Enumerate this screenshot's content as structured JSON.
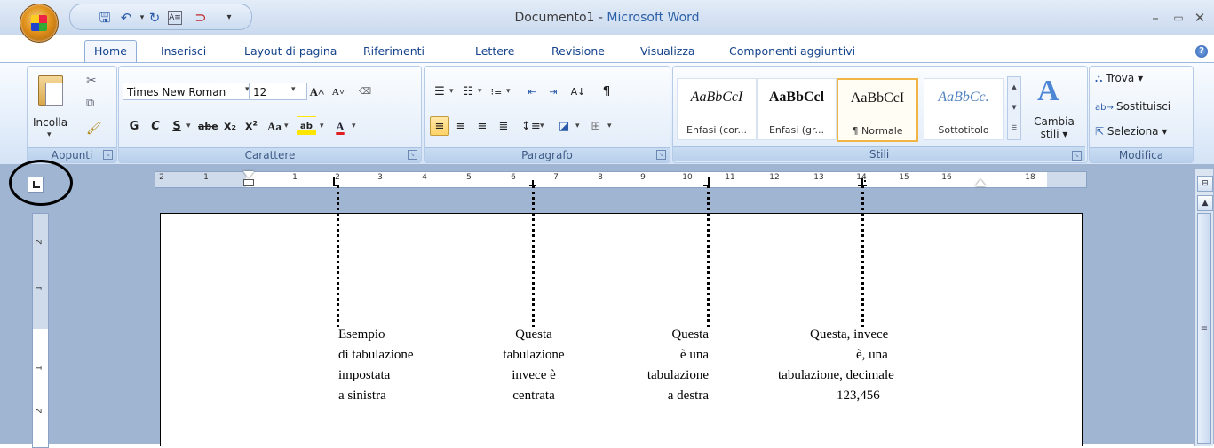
{
  "window": {
    "doc_name": "Documento1",
    "separator": " - ",
    "app_name": "Microsoft Word",
    "min_icon": "minimize-icon",
    "restore_icon": "restore-icon",
    "close_icon": "close-icon"
  },
  "quick_access": {
    "save_icon": "save-icon",
    "undo_icon": "undo-icon",
    "redo_icon": "redo-icon",
    "custom1_icon": "form-icon",
    "custom2_icon": "spelling-icon",
    "more_icon": "customize-qat-icon"
  },
  "tabs": [
    {
      "label": "Home"
    },
    {
      "label": "Inserisci"
    },
    {
      "label": "Layout di pagina"
    },
    {
      "label": "Riferimenti"
    },
    {
      "label": "Lettere"
    },
    {
      "label": "Revisione"
    },
    {
      "label": "Visualizza"
    },
    {
      "label": "Componenti aggiuntivi"
    }
  ],
  "clipboard": {
    "group_label": "Appunti",
    "paste_label": "Incolla"
  },
  "font": {
    "group_label": "Carattere",
    "family": "Times New Roman",
    "size": "12",
    "bold": "G",
    "italic": "C",
    "underline": "S",
    "strike": "abe",
    "subscript": "x₂",
    "superscript": "x²",
    "case": "Aa"
  },
  "paragraph": {
    "group_label": "Paragrafo"
  },
  "styles": {
    "group_label": "Stili",
    "tiles": [
      {
        "sample": "AaBbCcI",
        "name": "Enfasi (cor..."
      },
      {
        "sample": "AaBbCcl",
        "name": "Enfasi (gr..."
      },
      {
        "sample": "AaBbCcI",
        "name": "¶ Normale"
      },
      {
        "sample": "AaBbCc.",
        "name": "Sottotitolo"
      }
    ],
    "change_label_1": "Cambia",
    "change_label_2": "stili ▾"
  },
  "editing": {
    "group_label": "Modifica",
    "find": "Trova ▾",
    "replace": "Sostituisci",
    "select": "Seleziona ▾"
  },
  "ruler": {
    "numbers": [
      "2",
      "1",
      "1",
      "2",
      "3",
      "4",
      "5",
      "6",
      "7",
      "8",
      "9",
      "10",
      "11",
      "12",
      "13",
      "14",
      "15",
      "16",
      "18"
    ]
  },
  "vruler": {
    "numbers": [
      "2",
      "1",
      "1",
      "2"
    ]
  },
  "document": {
    "col1": [
      "Esempio",
      "di tabulazione",
      "impostata",
      "a sinistra"
    ],
    "col2": [
      "Questa",
      "tabulazione",
      "invece è",
      "centrata"
    ],
    "col3": [
      "Questa",
      "è una",
      "tabulazione",
      "a destra"
    ],
    "col4": [
      "Questa, invece",
      "è, una",
      "tabulazione, decimale",
      "123,456"
    ]
  }
}
